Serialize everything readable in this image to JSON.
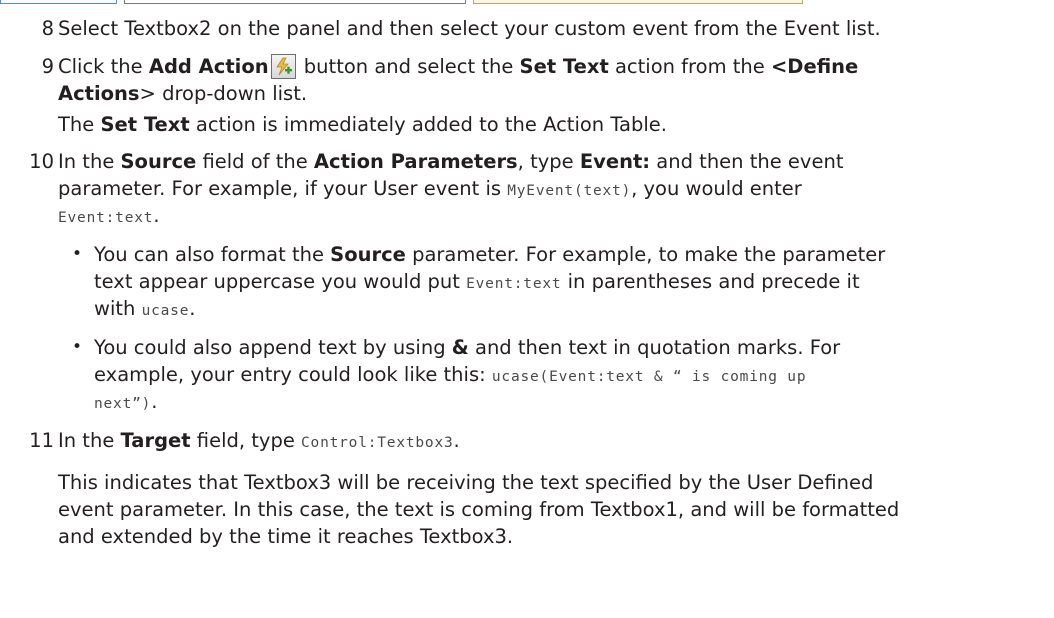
{
  "steps": {
    "s8": {
      "num": "8",
      "text": "Select Textbox2 on the panel and then select your custom event from the Event list."
    },
    "s9": {
      "num": "9",
      "p1": "Click the ",
      "b1": "Add Action",
      "p2": " button and select the ",
      "b2": "Set Text",
      "p3": " action from the ",
      "b3": "<Define",
      "b4": "Actions",
      "p4": "> drop-down list.",
      "r1": "The ",
      "rb1": "Set Text",
      "r2": " action is immediately added to the Action Table."
    },
    "s10": {
      "num": "10",
      "p1": "In the ",
      "b1": "Source",
      "p2": " field of the ",
      "b2": "Action Parameters",
      "p3": ", type ",
      "b3": "Event:",
      "p4": " and then the event",
      "l2a": "parameter. For example, if your User event is ",
      "l2code": "MyEvent(text)",
      "l2b": ", you would enter",
      "l3code": "Event:text",
      "l3b": ".",
      "bullets": [
        {
          "a": "You can also format the ",
          "b": "Source",
          "c": " parameter. For example, to make the parameter",
          "d": "text appear uppercase you would put ",
          "code1": "Event:text",
          "e": " in parentheses and precede it",
          "f": "with ",
          "code2": "ucase",
          "g": "."
        },
        {
          "a": "You could also append text by using ",
          "b": "&",
          "c": " and then text in quotation marks. For",
          "d": "example, your entry could look like this: ",
          "code1": "ucase(Event:text & “ is coming up",
          "code2": "next”)",
          "e": "."
        }
      ]
    },
    "s11": {
      "num": "11",
      "p1": "In the ",
      "b1": "Target",
      "p2": " field, type ",
      "code": "Control:Textbox3",
      "p3": ".",
      "para": [
        "This indicates that Textbox3 will be receiving the text specified by the User Defined",
        "event parameter. In this case, the text is coming from Textbox1, and will be formatted",
        "and extended by the time it reaches Textbox3."
      ]
    }
  },
  "icons": {
    "add_action": "lightning-plus-icon"
  },
  "colors": {
    "text": "#231f20",
    "code": "#4a4a4a",
    "frame_highlight": "#fbf6e2"
  }
}
